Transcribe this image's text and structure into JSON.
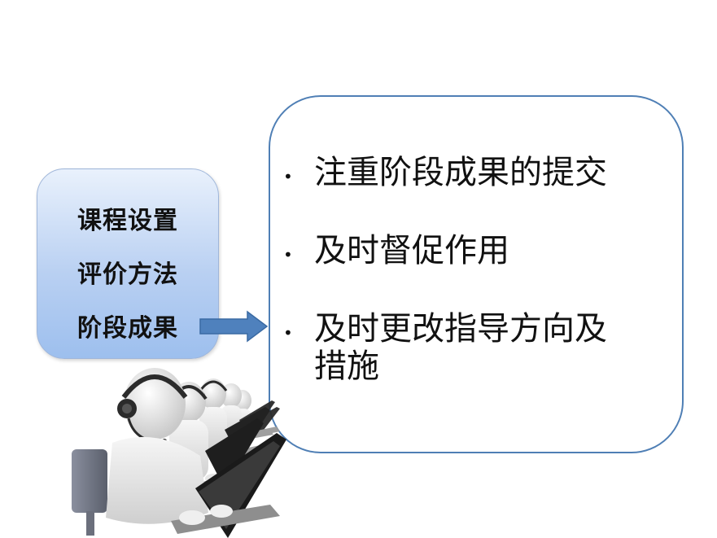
{
  "left_box": {
    "items": [
      "课程设置",
      "评价方法",
      "阶段成果"
    ]
  },
  "right_box": {
    "bullets": [
      "注重阶段成果的提交",
      "及时督促作用",
      "及时更改指导方向及措施"
    ]
  },
  "colors": {
    "box_border": "#4f7fb5",
    "left_box_fill": "#b9d0f2",
    "arrow_fill": "#4f81bd"
  },
  "icons": {
    "arrow": "right-arrow-icon",
    "figure": "call-center-operators-illustration"
  }
}
